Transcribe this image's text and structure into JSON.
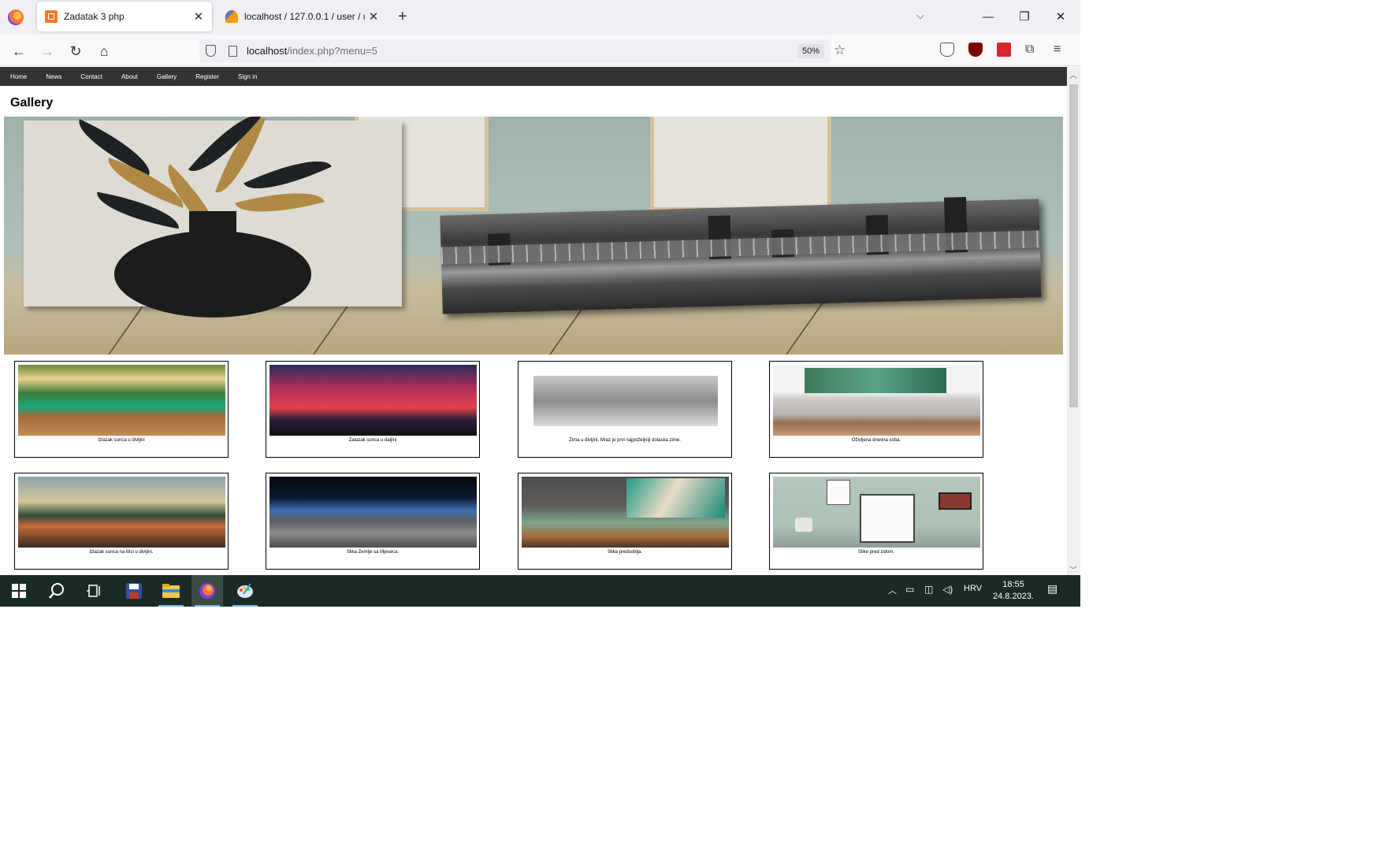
{
  "browser": {
    "tabs": [
      {
        "title": "Zadatak 3 php",
        "active": true
      },
      {
        "title": "localhost / 127.0.0.1 / user / use",
        "active": false
      }
    ],
    "url_host": "localhost",
    "url_path": "/index.php?menu=5",
    "zoom": "50%"
  },
  "site": {
    "nav": [
      "Home",
      "News",
      "Contact",
      "About",
      "Gallery",
      "Register",
      "Sign in"
    ],
    "page_title": "Gallery",
    "gallery": [
      {
        "caption": "Izlazak sunca u divljini"
      },
      {
        "caption": "Zalazak sunca u daljini"
      },
      {
        "caption": "Zima u divljini. Mraz je prvi najpoželjniji dolaska zime."
      },
      {
        "caption": "Oživljena dnevna soba."
      },
      {
        "caption": "Izlazak sunca na litici u divljini."
      },
      {
        "caption": "Slika Zemlje sa Mjeseca."
      },
      {
        "caption": "Slika predsoblja."
      },
      {
        "caption": "Slike pred zidom."
      }
    ]
  },
  "taskbar": {
    "language": "HRV",
    "time": "18:55",
    "date": "24.8.2023."
  }
}
